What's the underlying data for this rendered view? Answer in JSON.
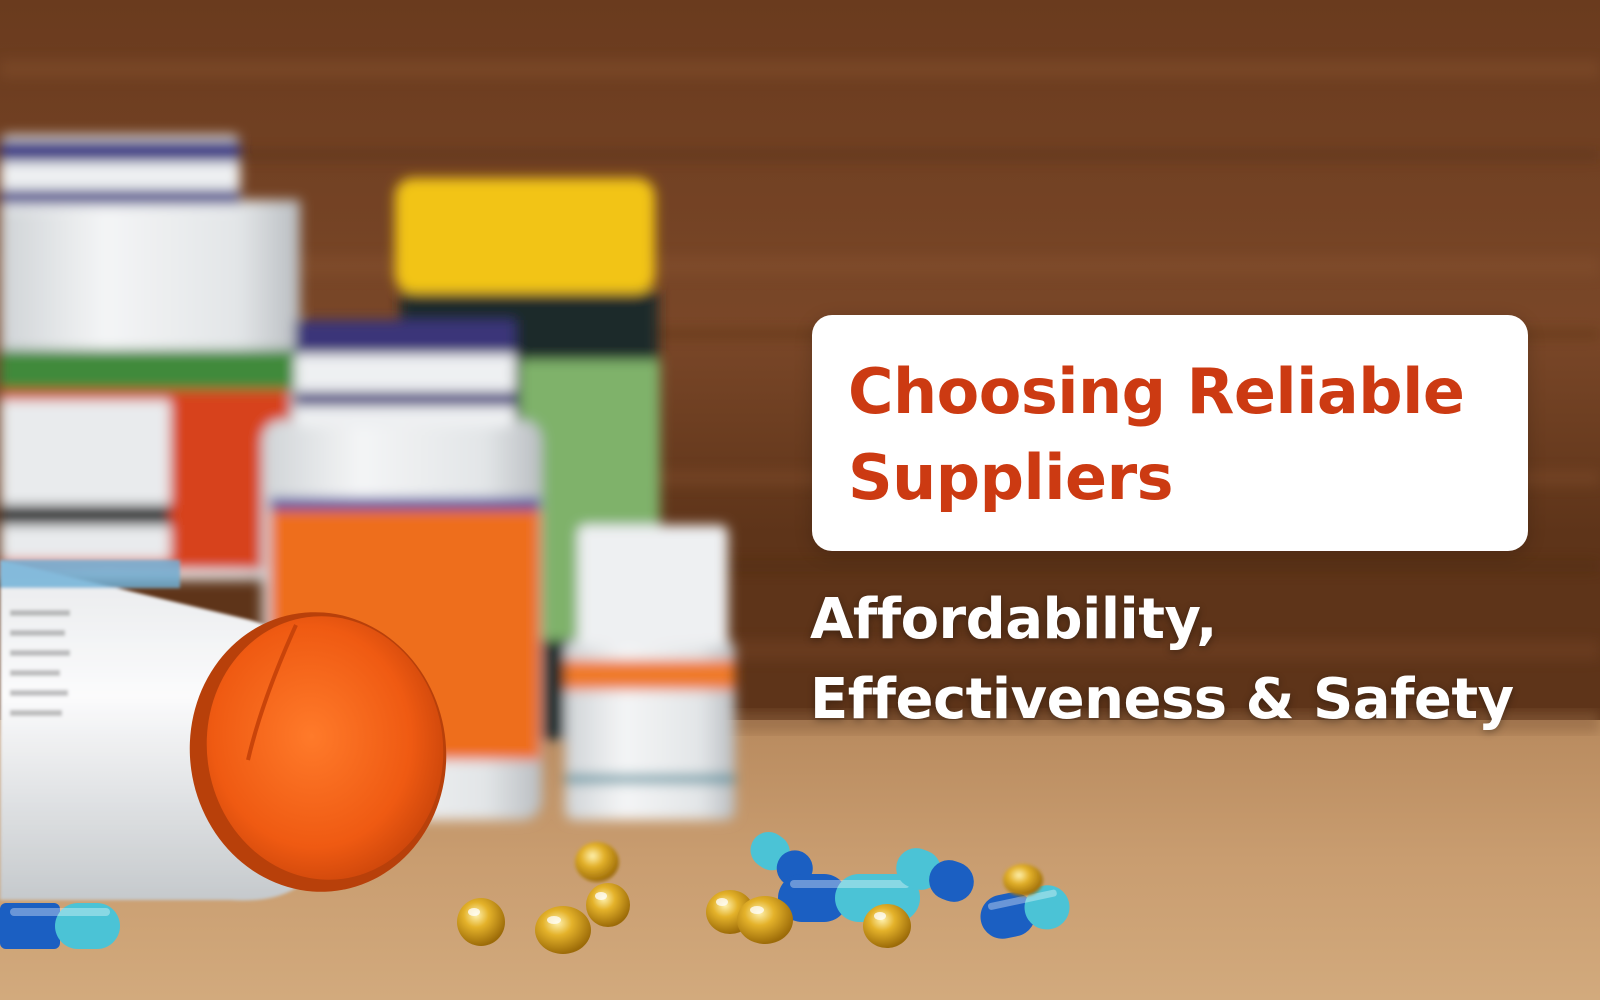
{
  "banner": {
    "title_lines": [
      "Choosing Reliable",
      "Suppliers"
    ],
    "subtitle_lines": [
      "Affordability,",
      "Effectiveness & Safety"
    ]
  },
  "colors": {
    "title_text": "#cc3a12",
    "card_background": "#ffffff",
    "subtitle_text": "#ffffff",
    "wood_background": "#6b3e22",
    "table_surface": "#c79a6c",
    "bottle_cap_orange": "#ef5a12",
    "bottle_cap_yellow": "#f2c418",
    "bottle_cap_navy": "#3a3579",
    "capsule_blue": "#1b5fc2",
    "capsule_cyan": "#4bc3d6",
    "softgel_amber": "#d9a21c"
  },
  "photo": {
    "subject": "pill bottles and capsules on wooden table"
  }
}
